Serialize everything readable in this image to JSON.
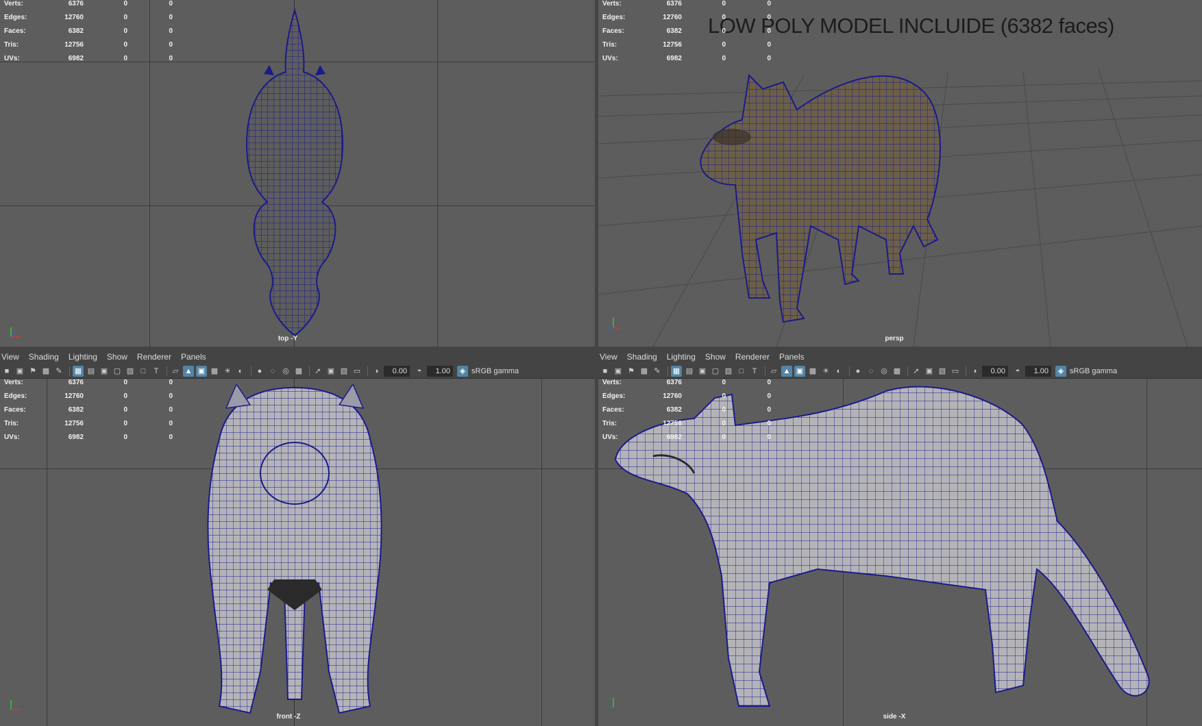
{
  "stats_labels": [
    "Verts:",
    "Edges:",
    "Faces:",
    "Tris:",
    "UVs:"
  ],
  "stats_values": [
    [
      "6376",
      "0",
      "0"
    ],
    [
      "12760",
      "0",
      "0"
    ],
    [
      "6382",
      "0",
      "0"
    ],
    [
      "12756",
      "0",
      "0"
    ],
    [
      "6982",
      "0",
      "0"
    ]
  ],
  "viewports": {
    "top": {
      "camera": "top -Y"
    },
    "persp": {
      "camera": "persp",
      "overlay_title": "LOW POLY MODEL INCLUIDE (6382 faces)"
    },
    "front": {
      "camera": "front -Z"
    },
    "side": {
      "camera": "side -X"
    }
  },
  "panel_menu": [
    "View",
    "Shading",
    "Lighting",
    "Show",
    "Renderer",
    "Panels"
  ],
  "panel_toolbar": {
    "exposure": "0.00",
    "gamma": "1.00",
    "color_space": "sRGB gamma"
  },
  "colors": {
    "viewport_bg": "#5d5d5d",
    "grid": "#3d3d3d",
    "wireframe": "#1a1a8c",
    "shaded_mesh": "#b4b4b8",
    "textured_fur": "#6b5f4a",
    "toolbar_active": "#5285a6"
  },
  "icons": {
    "axis_gizmo": "xyz-axis-icon"
  }
}
